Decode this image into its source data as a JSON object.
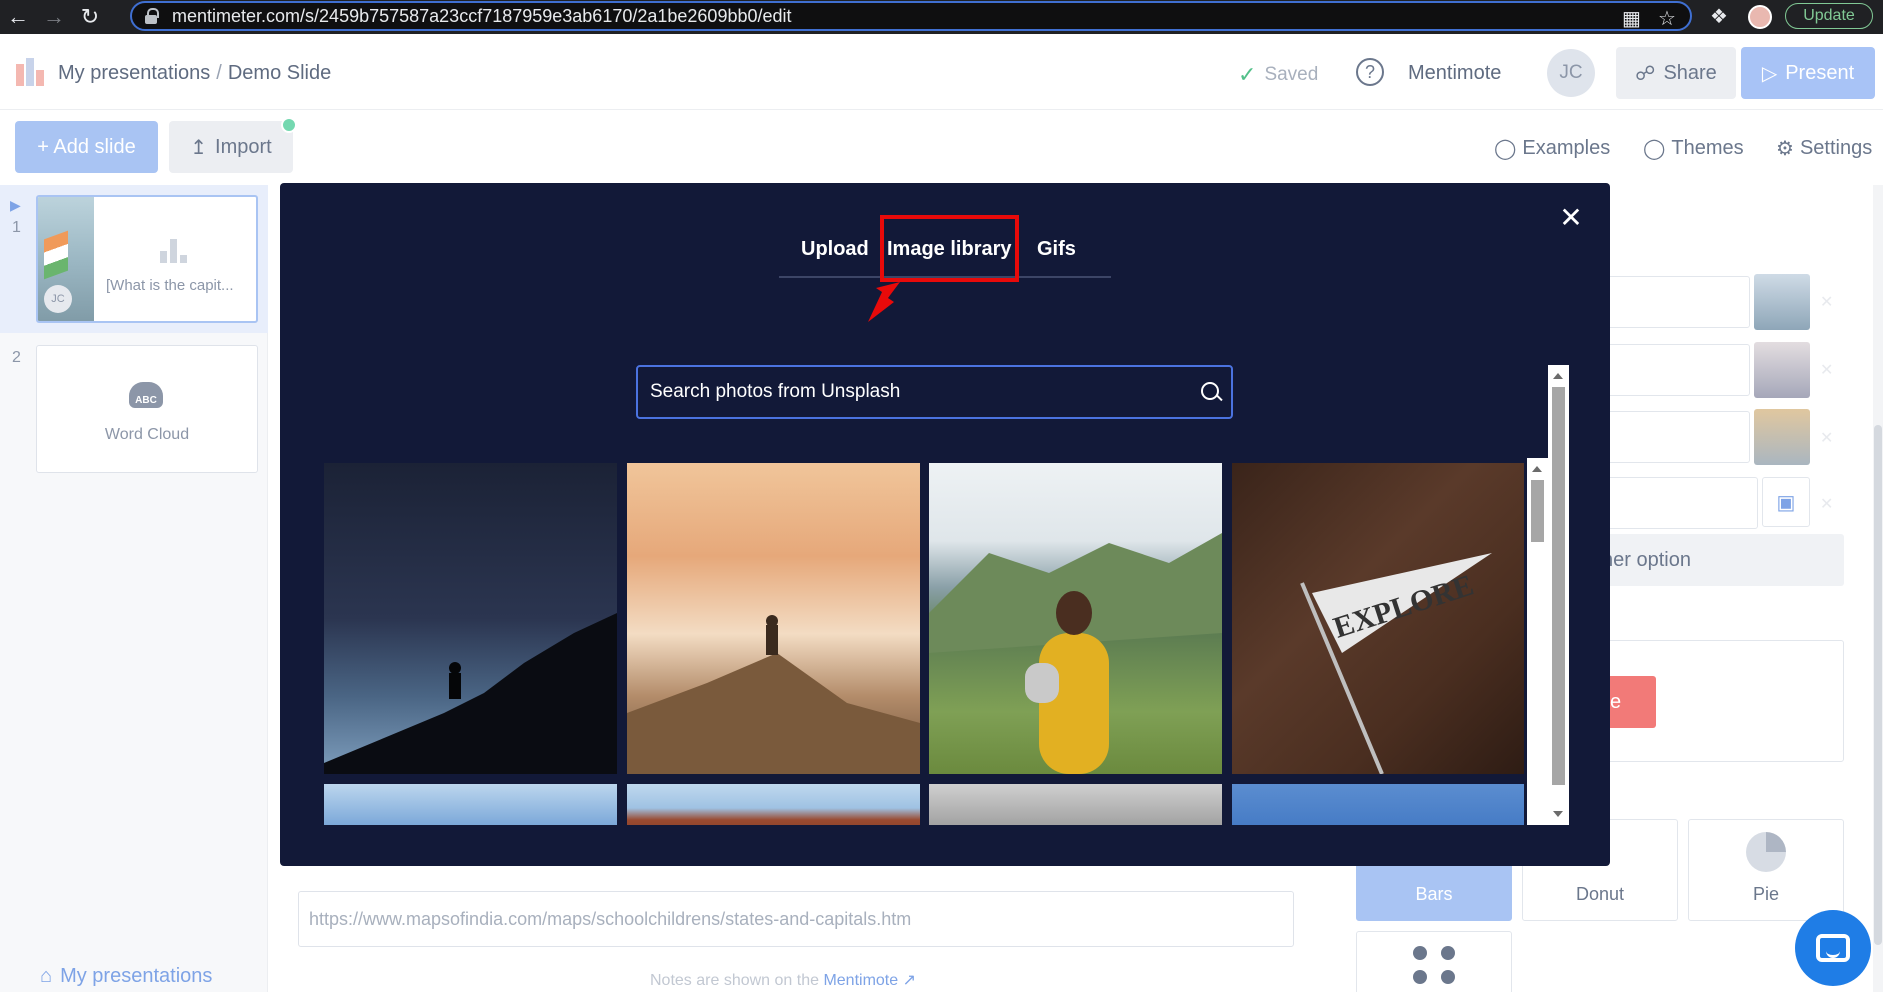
{
  "browser": {
    "url": "mentimeter.com/s/2459b757587a23ccf7187959e3ab6170/2a1be2609bb0/edit",
    "update_label": "Update"
  },
  "header": {
    "breadcrumb_root": "My presentations",
    "breadcrumb_sep": "/",
    "breadcrumb_current": "Demo Slide",
    "saved_label": "Saved",
    "help_glyph": "?",
    "mentimote_label": "Mentimote",
    "avatar_initials": "JC",
    "share_label": "Share",
    "present_label": "Present"
  },
  "toolbar": {
    "add_slide_label": "+ Add slide",
    "import_label": "Import",
    "examples_label": "Examples",
    "themes_label": "Themes",
    "settings_label": "Settings"
  },
  "sidebar": {
    "slides": [
      {
        "number": "1",
        "text": "[What is the capit...",
        "avatar": "JC"
      },
      {
        "number": "2",
        "text": "Word Cloud",
        "icon_text": "ABC"
      }
    ],
    "my_presentations_label": "My presentations"
  },
  "editor": {
    "add_option_partial": "her option",
    "remove_partial": "ve",
    "viz_types": [
      "Bars",
      "Donut",
      "Pie"
    ],
    "notes_value": "https://www.mapsofindia.com/maps/schoolchildrens/states-and-capitals.htm",
    "notes_hint": "Notes are shown on the",
    "notes_hint_link": "Mentimote"
  },
  "modal": {
    "tabs": [
      "Upload",
      "Image library",
      "Gifs"
    ],
    "active_tab": "Image library",
    "search_placeholder": "Search photos from Unsplash",
    "photos": [
      {
        "icon": "night-sky-silhouette"
      },
      {
        "icon": "sea-of-clouds-hiker"
      },
      {
        "icon": "hiker-backpack-valley"
      },
      {
        "icon": "explore-pennant"
      },
      {
        "icon": "blue-sky"
      },
      {
        "icon": "red-rock-sky"
      },
      {
        "icon": "travel-flatlay"
      },
      {
        "icon": "blue-sky-2"
      }
    ],
    "pennant_text": "EXPLORE"
  },
  "annotation": {
    "highlight_color": "#e80a0a"
  }
}
